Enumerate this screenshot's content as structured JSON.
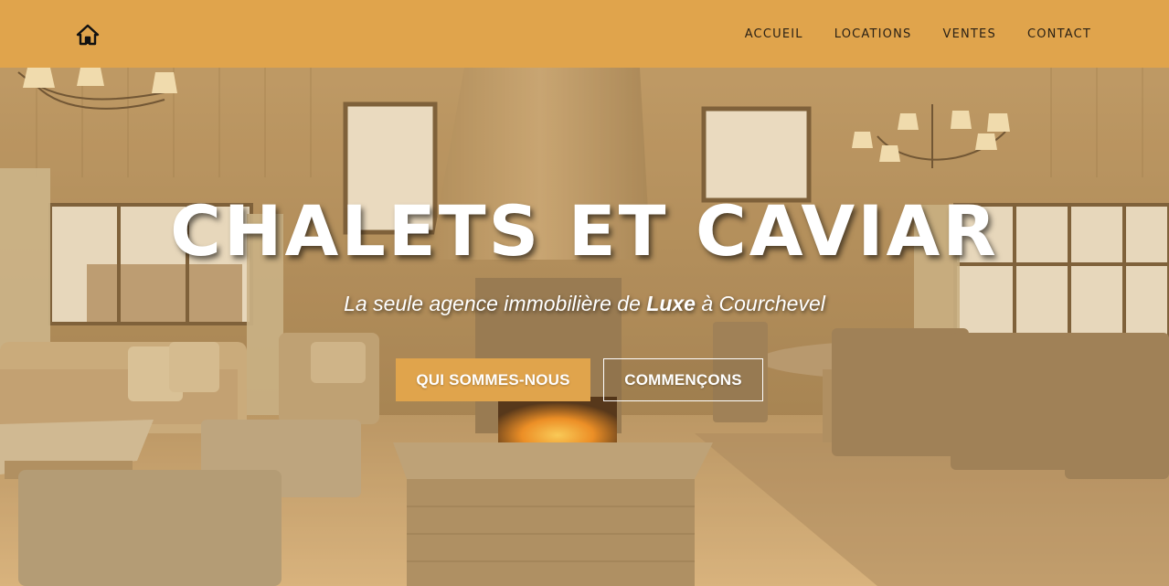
{
  "navbar": {
    "home_icon": "house-icon",
    "links": [
      "ACCUEIL",
      "LOCATIONS",
      "VENTES",
      "CONTACT"
    ]
  },
  "hero": {
    "title": "CHALETS ET CAVIAR",
    "subtitle_before": "La seule agence immobilière de ",
    "subtitle_bold": "Luxe",
    "subtitle_after": " à Courchevel",
    "background": "chalet-living-room-fireplace-photo",
    "primary_button": "QUI SOMMES-NOUS",
    "secondary_button": "COMMENÇONS"
  },
  "colors": {
    "accent": "#e0a44c",
    "nav_text": "#2a2116",
    "hero_text": "#ffffff"
  }
}
